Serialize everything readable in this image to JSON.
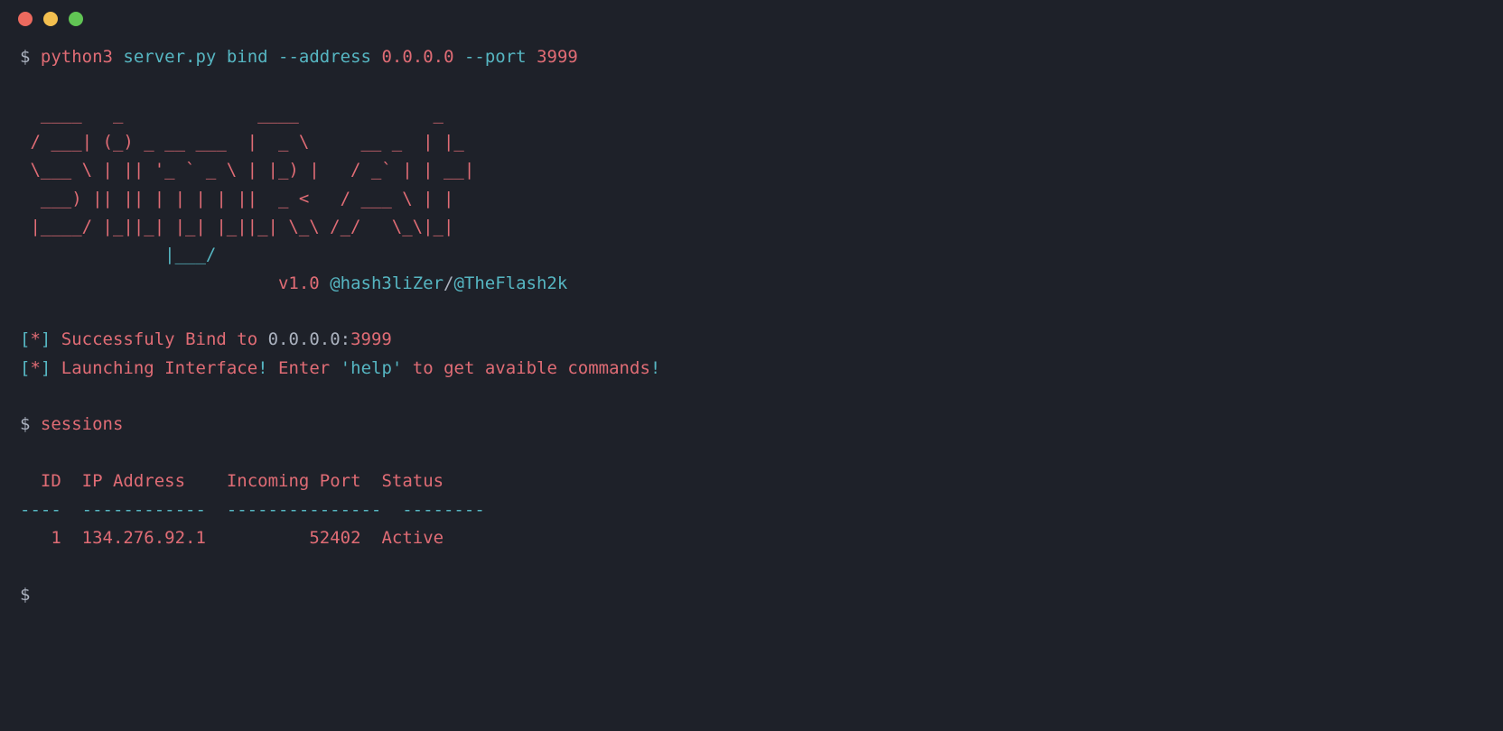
{
  "prompt": "$ ",
  "cmd": {
    "exe": "python3",
    "file": "server.py",
    "sub": "bind",
    "flag_addr": "--address",
    "addr": "0.0.0.0",
    "flag_port": "--port",
    "port": "3999"
  },
  "ascii": {
    "l1": "   _____ _             ____        _       ",
    "l2": "  / ____(_)           |  __ \\      | |  ",
    "l3": " | (___  _ _ __ ___   | |__) |__ _ | |_ ",
    "l4": "  \\___ \\| | '_ ` _ \\  |  _  // _` || __|",
    "l5": "  ____) | | | | | | |_| | \\ \\ (_| || |_ ",
    "l6": " |_____/|_|_| |_| |_(_)_|  \\_\\__,_(_)__|",
    "l7": "                                        "
  },
  "banner": {
    "version": "v1.0 ",
    "handle1": "@hash3liZer",
    "sep": "/",
    "handle2": "@TheFlash2k"
  },
  "status": {
    "bracket_open": "[",
    "star": "*",
    "bracket_close": "] ",
    "bind_msg": "Successfuly Bind to ",
    "bind_host": "0.0.0.0",
    "colon": ":",
    "bind_port": "3999",
    "launch_a": "Launching Interface",
    "bang1": "!",
    "launch_b": " Enter ",
    "quote": "'",
    "help": "help",
    "launch_c": " to get avaible commands",
    "bang2": "!"
  },
  "cmd2": "sessions",
  "table": {
    "hdr_id": "  ID",
    "hdr_ip": "IP Address  ",
    "hdr_port": "Incoming Port",
    "hdr_status": "Status  ",
    "rule": "----  ------------  ---------------  --------",
    "row_id": "   1",
    "row_ip": "134.276.92.1",
    "row_port": "        52402",
    "row_status": "Active"
  }
}
